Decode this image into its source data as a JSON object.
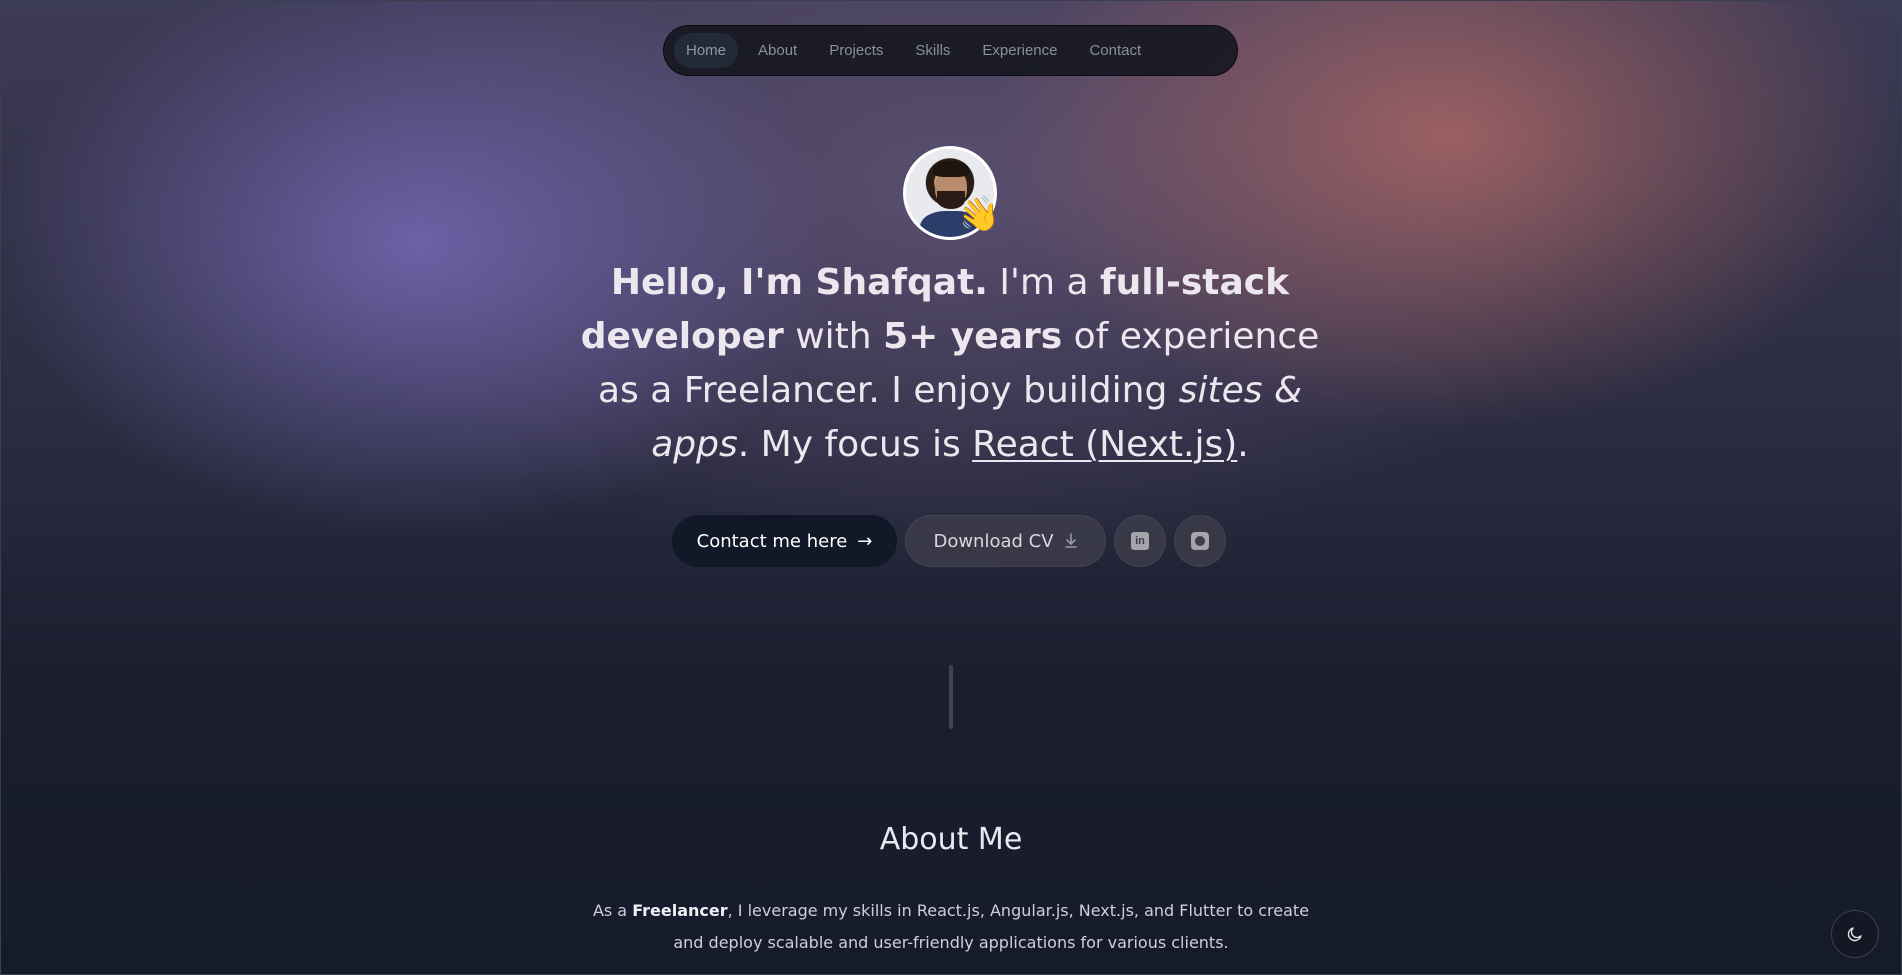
{
  "nav": {
    "items": [
      {
        "label": "Home",
        "active": true
      },
      {
        "label": "About"
      },
      {
        "label": "Projects"
      },
      {
        "label": "Skills"
      },
      {
        "label": "Experience"
      },
      {
        "label": "Contact"
      }
    ]
  },
  "hero": {
    "greeting": "Hello, I'm Shafqat.",
    "im_a": " I'm a ",
    "role_bold": "full-stack developer",
    "with": " with ",
    "years_bold": "5+ years",
    "experience": " of experience as a Freelancer. I enjoy building ",
    "sites_apps": "sites & apps",
    "focus": ". My focus is ",
    "focus_link": "React (Next.js)",
    "end": "."
  },
  "buttons": {
    "contact": "Contact me here",
    "download_cv": "Download CV",
    "linkedin_icon": "linkedin-icon",
    "github_icon": "github-icon"
  },
  "about": {
    "title": "About Me",
    "prefix": "As a ",
    "freelancer": "Freelancer",
    "rest": ", I leverage my skills in React.js, Angular.js, Next.js, and Flutter to create and deploy scalable and user-friendly applications for various clients."
  },
  "theme_toggle": {
    "icon": "moon-icon"
  }
}
